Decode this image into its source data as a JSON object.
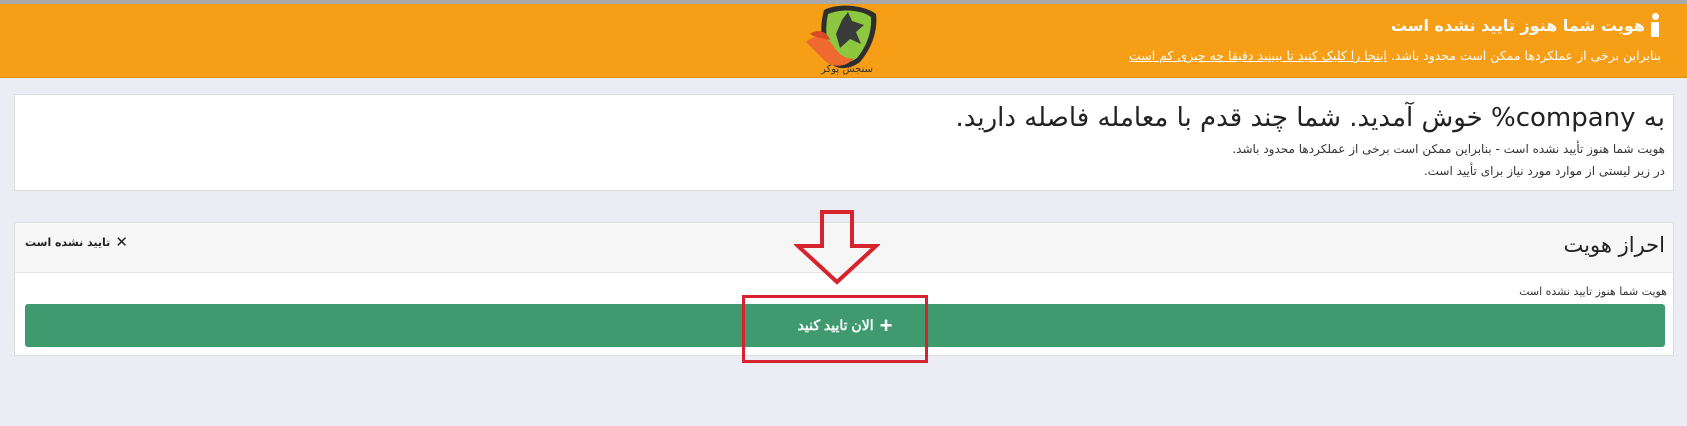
{
  "banner": {
    "title": "هویت شما هنوز تایید نشده است",
    "message": "بنابراین برخی از عملکردها ممکن است محدود باشد.",
    "link": "اینجا را کلیک کنید تا ببینید دقیقا چه چیزی کم است",
    "background_color": "#f59e16",
    "icon": "info-icon"
  },
  "logo": {
    "text": "سنجش پوکر"
  },
  "welcome": {
    "title": "به company% خوش آمدید. شما چند قدم با معامله فاصله دارید.",
    "line1": "هویت شما هنوز تأیید نشده است - بنابراین ممکن است برخی از عملکردها محدود باشد.",
    "line2": "در زیر لیستی از موارد مورد نیاز برای تأیید است."
  },
  "identity": {
    "title": "احراز هویت",
    "status": "تایید نشده است",
    "status_icon": "close-icon",
    "note": "هویت شما هنوز تایید نشده است",
    "button_label": "الان تایید کنید",
    "button_icon": "plus-icon",
    "button_color": "#3f9a70"
  },
  "annotation_color": "#d7232d"
}
